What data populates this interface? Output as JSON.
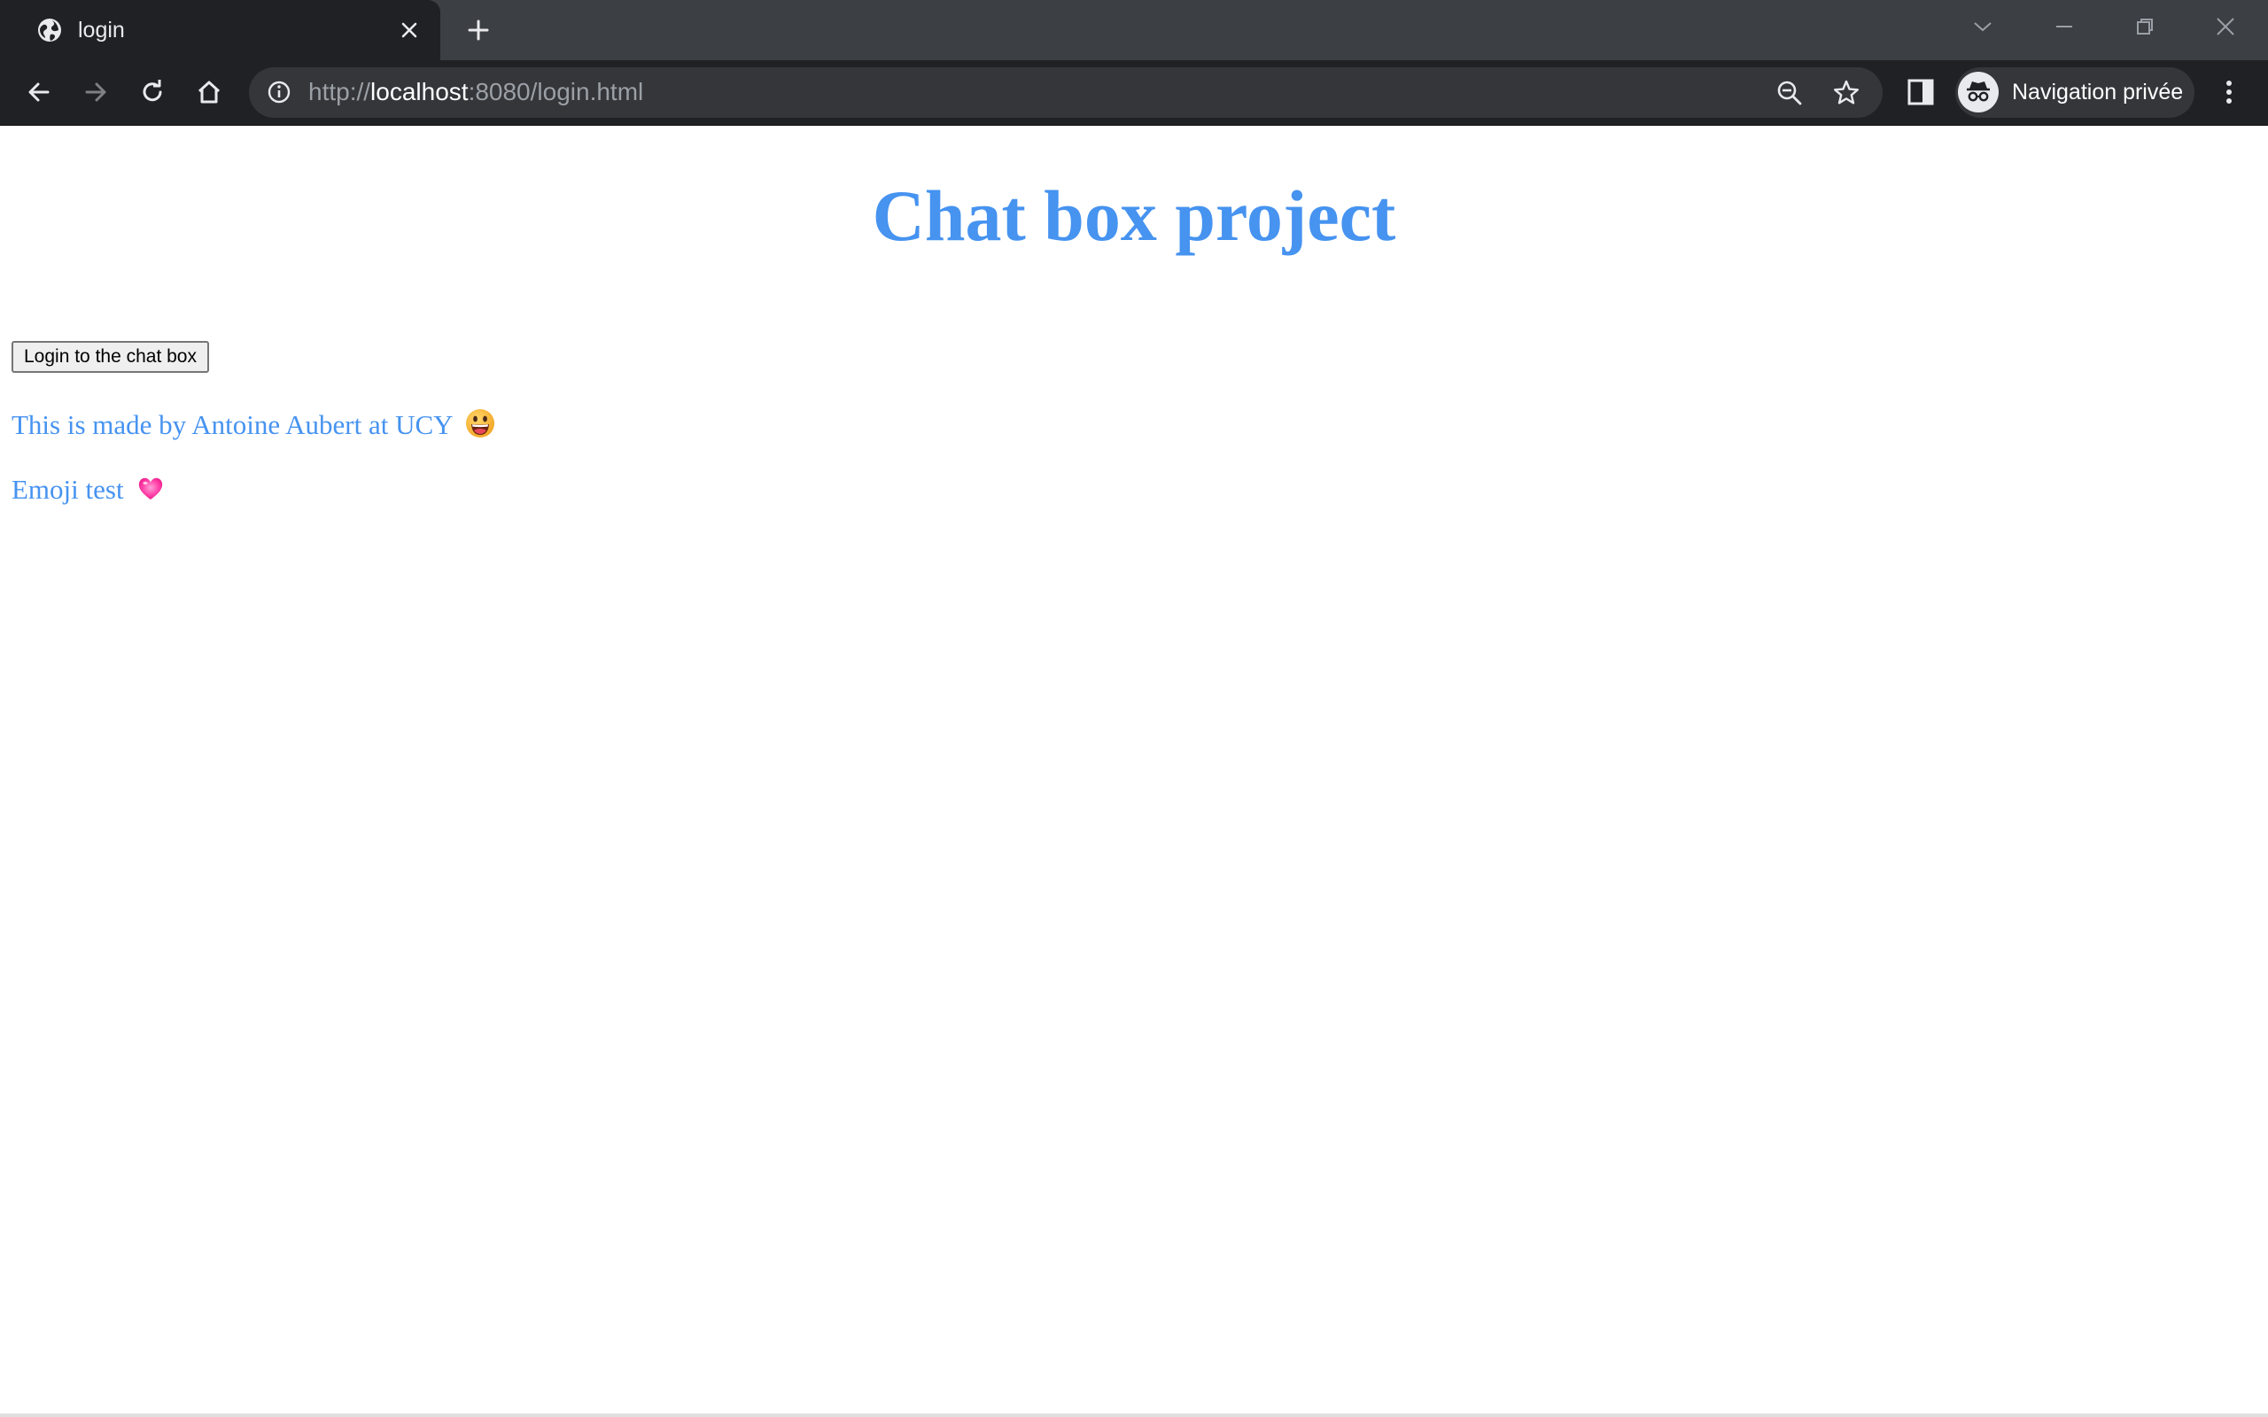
{
  "browser": {
    "tab": {
      "title": "login",
      "favicon": "globe-icon"
    },
    "address_bar": {
      "scheme": "http://",
      "host": "localhost",
      "rest": ":8080/login.html"
    },
    "profile": {
      "label": "Navigation privée",
      "icon": "incognito-icon"
    },
    "colors": {
      "tabstrip": "#3c3f44",
      "toolbar": "#202124",
      "omnibox": "#35363a"
    }
  },
  "page": {
    "title": "Chat box project",
    "login_button_label": "Login to the chat box",
    "credit_text": "This is made by Antoine Aubert at UCY",
    "credit_emoji": "grinning-face-emoji",
    "emoji_test_text": "Emoji test",
    "emoji_test_emoji": "pink-heart-emoji",
    "colors": {
      "accent": "#4693f0",
      "background": "#ffffff"
    }
  }
}
